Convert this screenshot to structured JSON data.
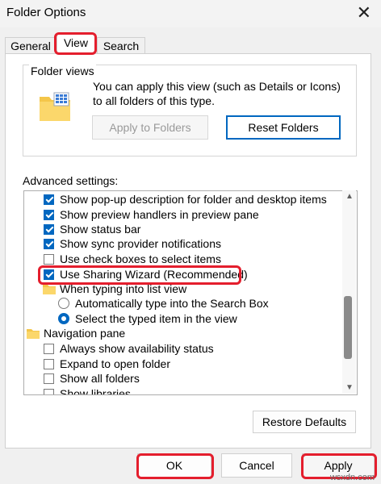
{
  "window": {
    "title": "Folder Options",
    "close_glyph": "✕"
  },
  "tabs": [
    {
      "label": "General"
    },
    {
      "label": "View",
      "selected": true
    },
    {
      "label": "Search"
    }
  ],
  "folder_views": {
    "group_label": "Folder views",
    "description": "You can apply this view (such as Details or Icons) to all folders of this type.",
    "apply_button": "Apply to Folders",
    "reset_button": "Reset Folders"
  },
  "advanced": {
    "label": "Advanced settings:",
    "items": [
      {
        "type": "checkbox",
        "label": "Show pop-up description for folder and desktop items",
        "checked": true
      },
      {
        "type": "checkbox",
        "label": "Show preview handlers in preview pane",
        "checked": true
      },
      {
        "type": "checkbox",
        "label": "Show status bar",
        "checked": true
      },
      {
        "type": "checkbox",
        "label": "Show sync provider notifications",
        "checked": true
      },
      {
        "type": "checkbox",
        "label": "Use check boxes to select items",
        "checked": false
      },
      {
        "type": "checkbox",
        "label": "Use Sharing Wizard (Recommended)",
        "checked": true
      },
      {
        "type": "folder",
        "label": "When typing into list view"
      },
      {
        "type": "radio",
        "label": "Automatically type into the Search Box",
        "selected": false
      },
      {
        "type": "radio",
        "label": "Select the typed item in the view",
        "selected": true
      },
      {
        "type": "folder",
        "label": "Navigation pane"
      },
      {
        "type": "checkbox",
        "label": "Always show availability status",
        "checked": false
      },
      {
        "type": "checkbox",
        "label": "Expand to open folder",
        "checked": false
      },
      {
        "type": "checkbox",
        "label": "Show all folders",
        "checked": false
      },
      {
        "type": "checkbox",
        "label": "Show libraries",
        "checked": false
      }
    ],
    "restore_button": "Restore Defaults"
  },
  "footer": {
    "ok": "OK",
    "cancel": "Cancel",
    "apply": "Apply"
  },
  "colors": {
    "accent": "#0067c0",
    "highlight": "#e41e2d"
  },
  "watermark": "wsxdn.com"
}
